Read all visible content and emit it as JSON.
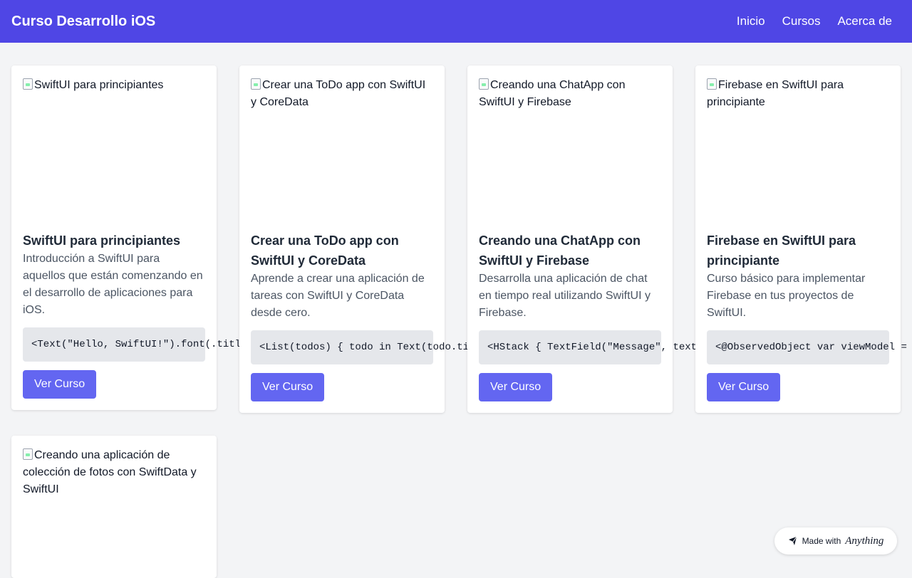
{
  "header": {
    "title": "Curso Desarrollo iOS",
    "nav": [
      "Inicio",
      "Cursos",
      "Acerca de"
    ]
  },
  "courses": [
    {
      "image_alt": "SwiftUI para principiantes",
      "title": "SwiftUI para principiantes",
      "description": "Introducción a SwiftUI para aquellos que están comenzando en el desarrollo de aplicaciones para iOS.",
      "code": "<Text(\"Hello, SwiftUI!\").font(.titl",
      "button": "Ver Curso"
    },
    {
      "image_alt": "Crear una ToDo app con SwiftUI y CoreData",
      "title": "Crear una ToDo app con SwiftUI y CoreData",
      "description": "Aprende a crear una aplicación de tareas con SwiftUI y CoreData desde cero.",
      "code": "<List(todos) { todo in Text(todo.ti",
      "button": "Ver Curso"
    },
    {
      "image_alt": "Creando una ChatApp con SwiftUI y Firebase",
      "title": "Creando una ChatApp con SwiftUI y Firebase",
      "description": "Desarrolla una aplicación de chat en tiempo real utilizando SwiftUI y Firebase.",
      "code": "<HStack { TextField(\"Message\", text",
      "button": "Ver Curso"
    },
    {
      "image_alt": "Firebase en SwiftUI para principiante",
      "title": "Firebase en SwiftUI para principiante",
      "description": "Curso básico para implementar Firebase en tus proyectos de SwiftUI.",
      "code": "<@ObservedObject var viewModel = ",
      "button": "Ver Curso"
    },
    {
      "image_alt": "Creando una aplicación de colección de fotos con SwiftData y SwiftUI"
    }
  ],
  "badge": {
    "made_with": "Made with",
    "brand": "Anything"
  },
  "colors": {
    "header": "#4f46e5",
    "button": "#6366f1",
    "background": "#f3f4f6"
  }
}
